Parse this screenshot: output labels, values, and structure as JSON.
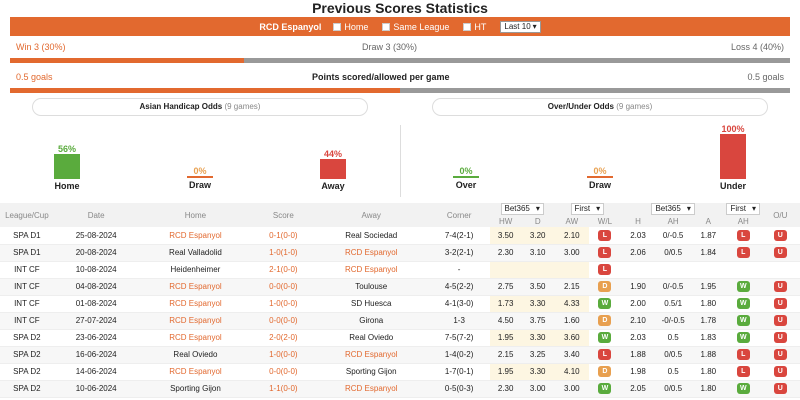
{
  "title": "Previous Scores Statistics",
  "filter": {
    "team": "RCD Espanyol",
    "options": [
      "Home",
      "Same League",
      "HT"
    ],
    "last": "Last 10"
  },
  "summary": {
    "win": "Win 3 (30%)",
    "draw": "Draw 3 (30%)",
    "loss": "Loss 4 (40%)",
    "win_pct": 30,
    "draw_pct": 30,
    "loss_pct": 40,
    "goals_left": "0.5 goals",
    "points_label": "Points scored/allowed per game",
    "goals_right": "0.5 goals",
    "points_ratio": 50
  },
  "asian": {
    "title": "Asian Handicap Odds",
    "games": "(9 games)",
    "home": {
      "pct": "56%",
      "label": "Home",
      "value": 56
    },
    "draw": {
      "pct": "0%",
      "label": "Draw",
      "value": 0
    },
    "away": {
      "pct": "44%",
      "label": "Away",
      "value": 44
    }
  },
  "overunder": {
    "title": "Over/Under Odds",
    "games": "(9 games)",
    "over": {
      "pct": "0%",
      "label": "Over",
      "value": 0
    },
    "draw": {
      "pct": "0%",
      "label": "Draw",
      "value": 0
    },
    "under": {
      "pct": "100%",
      "label": "Under",
      "value": 100
    }
  },
  "table": {
    "headers": [
      "League/Cup",
      "Date",
      "Home",
      "Score",
      "Away",
      "Corner",
      "W/L",
      "O/U"
    ],
    "book1": "Bet365",
    "first1": "First",
    "book2": "Bet365",
    "first2": "First",
    "sub1": [
      "HW",
      "D",
      "AW"
    ],
    "sub2": [
      "H",
      "AH",
      "A",
      "AH"
    ],
    "rows": [
      {
        "league": "SPA D1",
        "date": "25-08-2024",
        "home": "RCD Espanyol",
        "home_hl": true,
        "score": "0-1(0-0)",
        "away": "Real Sociedad",
        "away_hl": false,
        "corner": "7-4(2-1)",
        "hw": "3.50",
        "d": "3.20",
        "aw": "2.10",
        "wl": "L",
        "h": "2.03",
        "ah": "0/-0.5",
        "a": "1.87",
        "ahr": "L",
        "ou": "U"
      },
      {
        "league": "SPA D1",
        "date": "20-08-2024",
        "home": "Real Valladolid",
        "home_hl": false,
        "score": "1-0(1-0)",
        "away": "RCD Espanyol",
        "away_hl": true,
        "corner": "3-2(2-1)",
        "hw": "2.30",
        "d": "3.10",
        "aw": "3.00",
        "wl": "L",
        "h": "2.06",
        "ah": "0/0.5",
        "a": "1.84",
        "ahr": "L",
        "ou": "U"
      },
      {
        "league": "INT CF",
        "date": "10-08-2024",
        "home": "Heidenheimer",
        "home_hl": false,
        "score": "2-1(0-0)",
        "away": "RCD Espanyol",
        "away_hl": true,
        "corner": "-",
        "hw": "",
        "d": "",
        "aw": "",
        "wl": "L",
        "h": "",
        "ah": "",
        "a": "",
        "ahr": "",
        "ou": ""
      },
      {
        "league": "INT CF",
        "date": "04-08-2024",
        "home": "RCD Espanyol",
        "home_hl": true,
        "score": "0-0(0-0)",
        "away": "Toulouse",
        "away_hl": false,
        "corner": "4-5(2-2)",
        "hw": "2.75",
        "d": "3.50",
        "aw": "2.15",
        "wl": "D",
        "h": "1.90",
        "ah": "0/-0.5",
        "a": "1.95",
        "ahr": "W",
        "ou": "U"
      },
      {
        "league": "INT CF",
        "date": "01-08-2024",
        "home": "RCD Espanyol",
        "home_hl": true,
        "score": "1-0(0-0)",
        "away": "SD Huesca",
        "away_hl": false,
        "corner": "4-1(3-0)",
        "hw": "1.73",
        "d": "3.30",
        "aw": "4.33",
        "wl": "W",
        "h": "2.00",
        "ah": "0.5/1",
        "a": "1.80",
        "ahr": "W",
        "ou": "U"
      },
      {
        "league": "INT CF",
        "date": "27-07-2024",
        "home": "RCD Espanyol",
        "home_hl": true,
        "score": "0-0(0-0)",
        "away": "Girona",
        "away_hl": false,
        "corner": "1-3",
        "hw": "4.50",
        "d": "3.75",
        "aw": "1.60",
        "wl": "D",
        "h": "2.10",
        "ah": "-0/-0.5",
        "a": "1.78",
        "ahr": "W",
        "ou": "U"
      },
      {
        "league": "SPA D2",
        "date": "23-06-2024",
        "home": "RCD Espanyol",
        "home_hl": true,
        "score": "2-0(2-0)",
        "away": "Real Oviedo",
        "away_hl": false,
        "corner": "7-5(7-2)",
        "hw": "1.95",
        "d": "3.30",
        "aw": "3.60",
        "wl": "W",
        "h": "2.03",
        "ah": "0.5",
        "a": "1.83",
        "ahr": "W",
        "ou": "U"
      },
      {
        "league": "SPA D2",
        "date": "16-06-2024",
        "home": "Real Oviedo",
        "home_hl": false,
        "score": "1-0(0-0)",
        "away": "RCD Espanyol",
        "away_hl": true,
        "corner": "1-4(0-2)",
        "hw": "2.15",
        "d": "3.25",
        "aw": "3.40",
        "wl": "L",
        "h": "1.88",
        "ah": "0/0.5",
        "a": "1.88",
        "ahr": "L",
        "ou": "U"
      },
      {
        "league": "SPA D2",
        "date": "14-06-2024",
        "home": "RCD Espanyol",
        "home_hl": true,
        "score": "0-0(0-0)",
        "away": "Sporting Gijon",
        "away_hl": false,
        "corner": "1-7(0-1)",
        "hw": "1.95",
        "d": "3.30",
        "aw": "4.10",
        "wl": "D",
        "h": "1.98",
        "ah": "0.5",
        "a": "1.80",
        "ahr": "L",
        "ou": "U"
      },
      {
        "league": "SPA D2",
        "date": "10-06-2024",
        "home": "Sporting Gijon",
        "home_hl": false,
        "score": "1-1(0-0)",
        "away": "RCD Espanyol",
        "away_hl": true,
        "corner": "0-5(0-3)",
        "hw": "2.30",
        "d": "3.00",
        "aw": "3.00",
        "wl": "W",
        "h": "2.05",
        "ah": "0/0.5",
        "a": "1.80",
        "ahr": "W",
        "ou": "U"
      }
    ]
  },
  "colors": {
    "accent": "#e2692f",
    "green": "#5aab3d",
    "red": "#d9463e",
    "orange": "#e8a050",
    "grey": "#999999"
  }
}
